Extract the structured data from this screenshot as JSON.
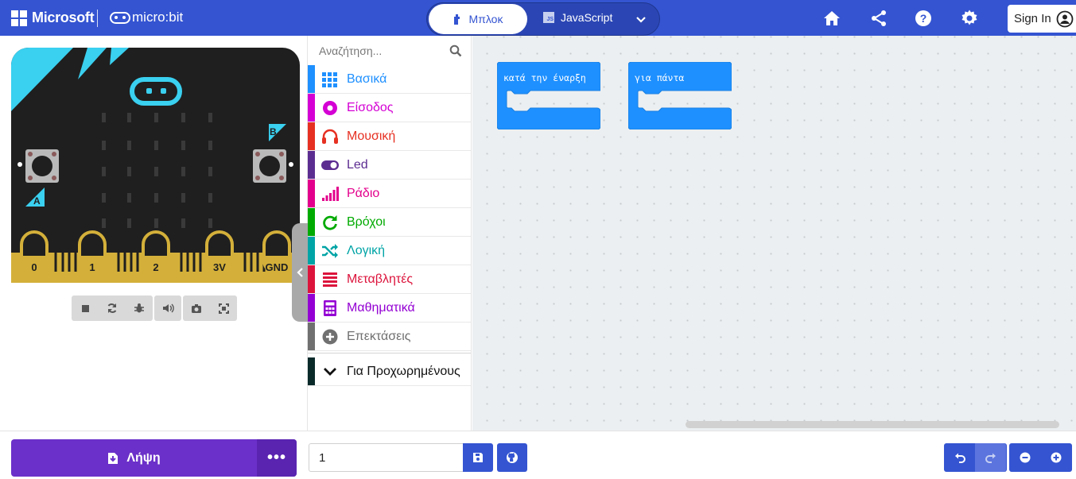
{
  "header": {
    "brand": "Microsoft",
    "product": "micro:bit",
    "tab_blocks": "Μπλοκ",
    "tab_js": "JavaScript",
    "js_badge": "JS",
    "sign_in": "Sign In"
  },
  "simulator": {
    "pins": [
      "0",
      "1",
      "2",
      "3V",
      "GND"
    ],
    "button_a": "A",
    "button_b": "B"
  },
  "toolbox": {
    "search_placeholder": "Αναζήτηση...",
    "categories": [
      {
        "label": "Βασικά",
        "color": "#1e90ff",
        "icon": "grid-icon"
      },
      {
        "label": "Είσοδος",
        "color": "#d400d4",
        "icon": "input-target-icon"
      },
      {
        "label": "Μουσική",
        "color": "#e63022",
        "icon": "headphones-icon"
      },
      {
        "label": "Led",
        "color": "#5c2d91",
        "icon": "toggle-icon"
      },
      {
        "label": "Ράδιο",
        "color": "#e3008c",
        "icon": "signal-bars-icon"
      },
      {
        "label": "Βρόχοι",
        "color": "#00aa00",
        "icon": "refresh-loop-icon"
      },
      {
        "label": "Λογική",
        "color": "#00a4a6",
        "icon": "shuffle-icon"
      },
      {
        "label": "Μεταβλητές",
        "color": "#dc143c",
        "icon": "list-lines-icon"
      },
      {
        "label": "Μαθηματικά",
        "color": "#9400d3",
        "icon": "calculator-icon"
      },
      {
        "label": "Επεκτάσεις",
        "color": "#707070",
        "icon": "plus-circle-icon"
      }
    ],
    "advanced": {
      "label": "Για Προχωρημένους",
      "color": "#0a2a2a"
    }
  },
  "workspace": {
    "blocks": [
      {
        "label": "κατά την έναρξη",
        "color": "#1e90ff"
      },
      {
        "label": "για πάντα",
        "color": "#1e90ff"
      }
    ]
  },
  "footer": {
    "download_label": "Λήψη",
    "more_label": "•••",
    "project_name": "1"
  },
  "colors": {
    "header": "#3454d1",
    "download": "#6b30c9",
    "board": "#1f1f1f",
    "board_accent": "#3ad0f0",
    "pin_gold": "#d4b03a"
  }
}
